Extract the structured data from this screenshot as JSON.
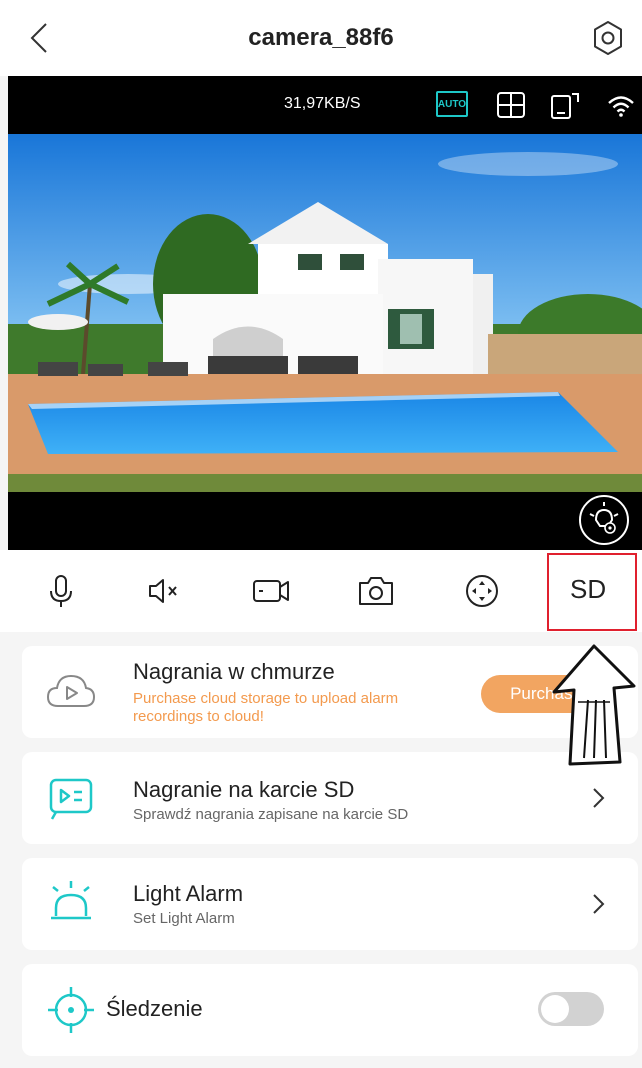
{
  "header": {
    "title": "camera_88f6"
  },
  "video": {
    "speed": "31,97KB/S",
    "auto_label": "AUTO"
  },
  "toolbar": {
    "sd_label": "SD"
  },
  "cards": {
    "cloud": {
      "title": "Nagrania w chmurze",
      "subtitle": "Purchase cloud storage to upload alarm recordings to cloud!",
      "button": "Purchase"
    },
    "sd": {
      "title": "Nagranie na karcie SD",
      "subtitle": "Sprawdź nagrania zapisane na karcie SD"
    },
    "light": {
      "title": "Light Alarm",
      "subtitle": "Set Light Alarm"
    },
    "tracking": {
      "title": "Śledzenie",
      "enabled": false
    }
  },
  "colors": {
    "accent": "#1ec8c8",
    "orange": "#f2a561",
    "highlight": "#e0202e"
  }
}
